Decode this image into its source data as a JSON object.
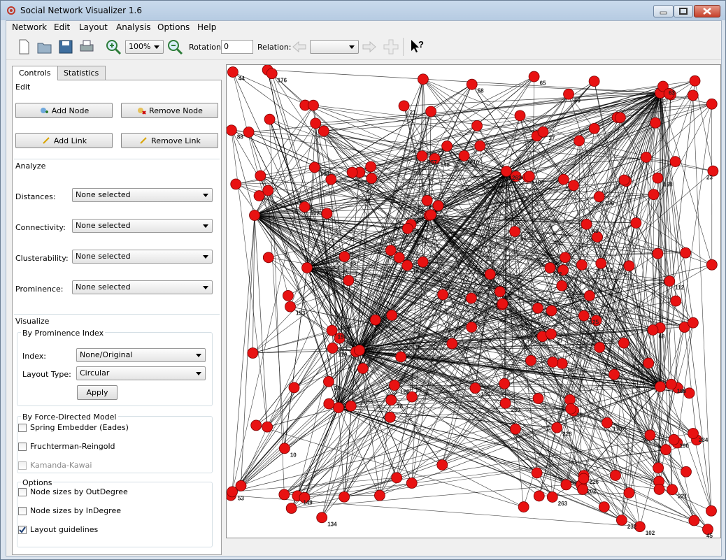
{
  "window": {
    "title": "Social Network Visualizer 1.6"
  },
  "menu": [
    "Network",
    "Edit",
    "Layout",
    "Analysis",
    "Options",
    "Help"
  ],
  "toolbar": {
    "zoom_value": "100%",
    "rotation_label": "Rotation:",
    "rotation_value": "0",
    "relation_label": "Relation:",
    "relation_value": ""
  },
  "tabs": {
    "controls": "Controls",
    "statistics": "Statistics"
  },
  "edit": {
    "title": "Edit",
    "add_node": "Add Node",
    "remove_node": "Remove Node",
    "add_link": "Add Link",
    "remove_link": "Remove Link"
  },
  "analyze": {
    "title": "Analyze",
    "rows": [
      {
        "label": "Distances:",
        "value": "None selected"
      },
      {
        "label": "Connectivity:",
        "value": "None selected"
      },
      {
        "label": "Clusterability:",
        "value": "None selected"
      },
      {
        "label": "Prominence:",
        "value": "None selected"
      }
    ]
  },
  "visualize": {
    "title": "Visualize",
    "prominence_title": "By Prominence Index",
    "index_label": "Index:",
    "index_value": "None/Original",
    "layout_type_label": "Layout Type:",
    "layout_type_value": "Circular",
    "apply": "Apply",
    "force_title": "By Force-Directed Model",
    "force_options": [
      {
        "label": "Spring Embedder (Eades)",
        "checked": false,
        "enabled": true
      },
      {
        "label": "Fruchterman-Reingold",
        "checked": false,
        "enabled": true
      },
      {
        "label": "Kamanda-Kawai",
        "checked": false,
        "enabled": false
      }
    ],
    "options_title": "Options",
    "options": [
      {
        "label": "Node sizes by OutDegree",
        "checked": false
      },
      {
        "label": "Node sizes by InDegree",
        "checked": false
      },
      {
        "label": "Layout guidelines",
        "checked": true
      }
    ]
  },
  "graph": {
    "node_color": "#e81212",
    "edge_color": "#000000",
    "labels": [
      "262",
      "39",
      "125",
      "96",
      "59",
      "153",
      "221",
      "102",
      "226",
      "148",
      "263",
      "147",
      "112",
      "136",
      "51",
      "10",
      "23",
      "149",
      "196",
      "106",
      "168",
      "53",
      "134",
      "198",
      "58",
      "63",
      "14",
      "45",
      "48",
      "45",
      "37",
      "210",
      "174",
      "244",
      "22",
      "185",
      "202",
      "176",
      "26",
      "228",
      "232",
      "119",
      "92",
      "44",
      "179",
      "27",
      "259",
      "102",
      "21",
      "234",
      "190",
      "68",
      "157",
      "128",
      "88",
      "164",
      "65",
      "78",
      "15",
      "18"
    ]
  },
  "colors": {
    "accent": "#3b6ea5",
    "node": "#e81212"
  }
}
